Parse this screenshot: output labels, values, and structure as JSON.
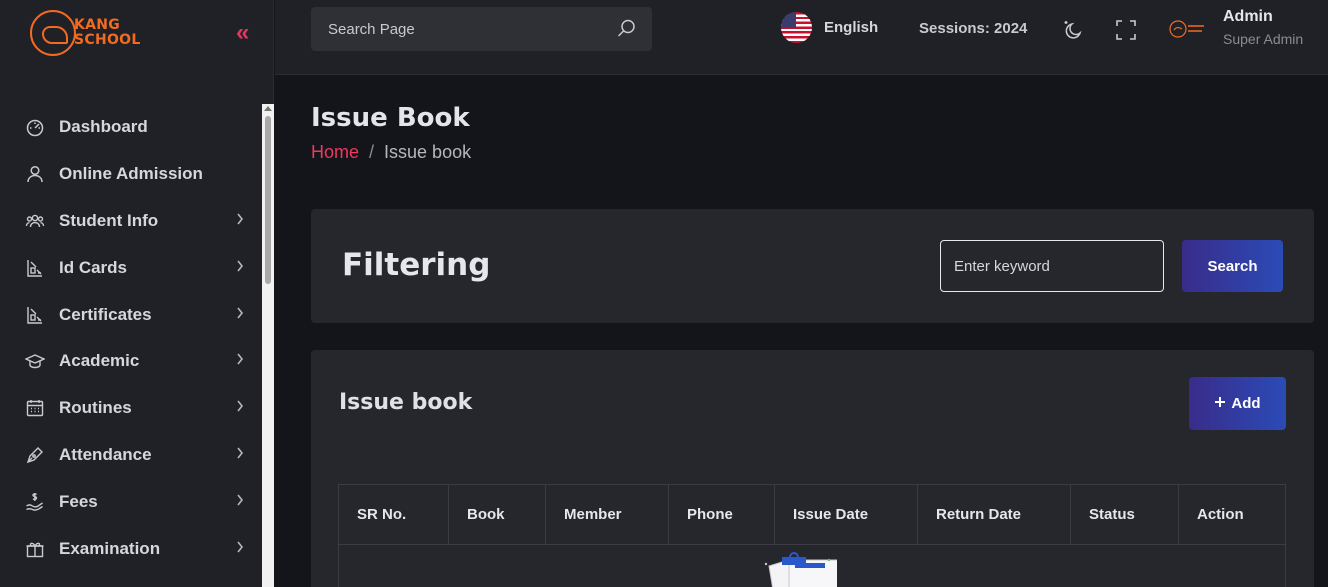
{
  "sidebar": {
    "logo_top": "KANG",
    "logo_bottom": "SCHOOL",
    "collapse_glyph": "«",
    "items": [
      {
        "label": "Dashboard",
        "icon": "dashboard-icon",
        "has_children": false
      },
      {
        "label": "Online Admission",
        "icon": "user-icon",
        "has_children": false
      },
      {
        "label": "Student Info",
        "icon": "users-icon",
        "has_children": true
      },
      {
        "label": "Id Cards",
        "icon": "id-card-icon",
        "has_children": true
      },
      {
        "label": "Certificates",
        "icon": "certificate-icon",
        "has_children": true
      },
      {
        "label": "Academic",
        "icon": "graduation-cap-icon",
        "has_children": true
      },
      {
        "label": "Routines",
        "icon": "calendar-icon",
        "has_children": true
      },
      {
        "label": "Attendance",
        "icon": "pen-icon",
        "has_children": true
      },
      {
        "label": "Fees",
        "icon": "money-icon",
        "has_children": true
      },
      {
        "label": "Examination",
        "icon": "gift-box-icon",
        "has_children": true
      }
    ]
  },
  "header": {
    "search_placeholder": "Search Page",
    "language": "English",
    "session": "Sessions: 2024",
    "user_name": "Admin",
    "user_role": "Super Admin"
  },
  "page": {
    "title": "Issue Book",
    "breadcrumb_home": "Home",
    "breadcrumb_sep": "/",
    "breadcrumb_current": "Issue book"
  },
  "filter": {
    "title": "Filtering",
    "keyword_placeholder": "Enter keyword",
    "search_label": "Search"
  },
  "issue": {
    "title": "Issue book",
    "add_label": "Add",
    "columns": [
      "SR No.",
      "Book",
      "Member",
      "Phone",
      "Issue Date",
      "Return Date",
      "Status",
      "Action"
    ]
  },
  "colors": {
    "accent_red": "#f0385e",
    "brand_orange": "#f26b21",
    "button_gradient_start": "#392c8a",
    "button_gradient_end": "#2b4bb7"
  }
}
